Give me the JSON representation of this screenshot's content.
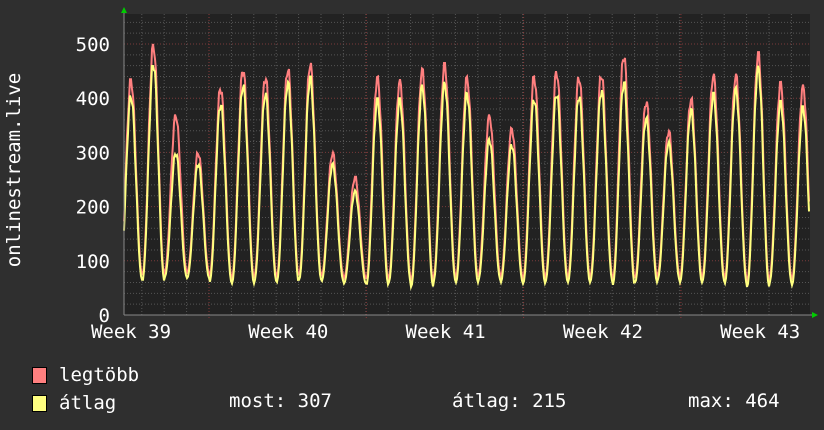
{
  "chart_data": {
    "type": "line",
    "ylabel": "onlinestream.live",
    "ylim": [
      0,
      550
    ],
    "yticks": [
      0,
      100,
      200,
      300,
      400,
      500
    ],
    "xtick_labels": [
      "Week 39",
      "Week 40",
      "Week 41",
      "Week 42",
      "Week 43"
    ],
    "grid": true,
    "series": [
      {
        "name": "legtöbb",
        "color": "#ff7f7f",
        "daily_peaks": [
          435,
          500,
          370,
          300,
          420,
          455,
          440,
          455,
          465,
          300,
          255,
          440,
          435,
          455,
          465,
          440,
          370,
          345,
          440,
          450,
          440,
          445,
          480,
          395,
          340,
          400,
          445,
          445,
          485,
          430,
          425
        ],
        "daily_troughs": [
          75,
          72,
          80,
          78,
          70,
          68,
          72,
          70,
          75,
          72,
          68,
          65,
          70,
          62,
          72,
          70,
          75,
          70,
          68,
          72,
          70,
          72,
          65,
          70,
          75,
          70,
          72,
          68,
          62,
          70,
          65
        ]
      },
      {
        "name": "átlag",
        "color": "#ffff80",
        "daily_peaks": [
          405,
          465,
          300,
          280,
          390,
          425,
          410,
          430,
          440,
          280,
          230,
          400,
          400,
          425,
          430,
          410,
          325,
          315,
          400,
          410,
          405,
          415,
          430,
          365,
          320,
          380,
          410,
          420,
          460,
          395,
          385
        ],
        "daily_troughs": [
          65,
          62,
          70,
          68,
          60,
          58,
          62,
          60,
          65,
          62,
          58,
          55,
          60,
          52,
          62,
          60,
          65,
          60,
          58,
          62,
          60,
          62,
          55,
          60,
          65,
          60,
          62,
          58,
          52,
          60,
          55
        ]
      }
    ]
  },
  "legend": {
    "max_label": "legtöbb",
    "avg_label": "átlag",
    "most": "most: 307",
    "atlag": "átlag: 215",
    "max": "max: 464"
  }
}
